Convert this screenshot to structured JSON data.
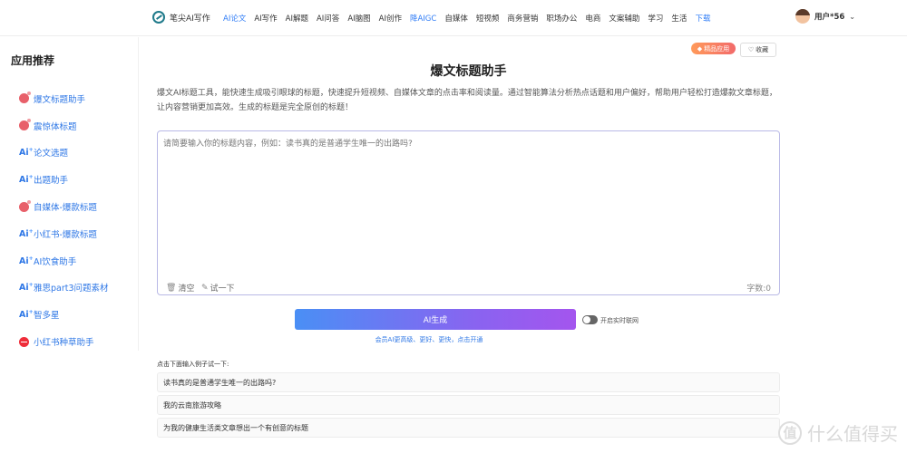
{
  "header": {
    "logo_text": "笔尖AI写作",
    "nav": [
      {
        "label": "AI论文",
        "highlight": true
      },
      {
        "label": "AI写作",
        "highlight": false
      },
      {
        "label": "AI解题",
        "highlight": false
      },
      {
        "label": "AI问答",
        "highlight": false
      },
      {
        "label": "AI脑图",
        "highlight": false
      },
      {
        "label": "AI创作",
        "highlight": false
      },
      {
        "label": "降AIGC",
        "highlight": true
      },
      {
        "label": "自媒体",
        "highlight": false
      },
      {
        "label": "短视频",
        "highlight": false
      },
      {
        "label": "商务营销",
        "highlight": false
      },
      {
        "label": "职场办公",
        "highlight": false
      },
      {
        "label": "电商",
        "highlight": false
      },
      {
        "label": "文案辅助",
        "highlight": false
      },
      {
        "label": "学习",
        "highlight": false
      },
      {
        "label": "生活",
        "highlight": false
      },
      {
        "label": "下载",
        "highlight": true
      }
    ],
    "user_name": "用户*56",
    "user_chevron": "⌄"
  },
  "sidebar": {
    "title": "应用推荐",
    "items": [
      {
        "label": "爆文标题助手",
        "icon": "bomb"
      },
      {
        "label": "震惊体标题",
        "icon": "bomb"
      },
      {
        "label": "论文选题",
        "icon": "ai"
      },
      {
        "label": "出题助手",
        "icon": "ai"
      },
      {
        "label": "自媒体-爆款标题",
        "icon": "bomb"
      },
      {
        "label": "小红书-爆款标题",
        "icon": "ai"
      },
      {
        "label": "AI饮食助手",
        "icon": "ai"
      },
      {
        "label": "雅思part3问题素材",
        "icon": "ai"
      },
      {
        "label": "智多星",
        "icon": "ai"
      },
      {
        "label": "小红书种草助手",
        "icon": "red"
      }
    ]
  },
  "main": {
    "premium_badge": "精品应用",
    "fav_label": "收藏",
    "title": "爆文标题助手",
    "description": "爆文AI标题工具，能快速生成吸引眼球的标题，快速提升短视频、自媒体文章的点击率和阅读量。通过智能算法分析热点话题和用户偏好，帮助用户轻松打造爆款文章标题，让内容营销更加高效。生成的标题是完全原创的标题！",
    "input_placeholder": "请简要输入你的标题内容，例如：读书真的是普通学生唯一的出路吗?",
    "clear_label": "清空",
    "try_label": "试一下",
    "char_count": "字数:0",
    "generate_label": "AI生成",
    "toggle_label": "开启实时联网",
    "vip_link": "会员AI更高级、更好、更快，点击开通",
    "examples_hint": "点击下面输入例子试一下:",
    "examples": [
      "读书真的是普通学生唯一的出路吗?",
      "我的云南旅游攻略",
      "为我的健康生活类文章想出一个有创意的标题"
    ]
  },
  "watermark": {
    "icon_char": "值",
    "text": "什么值得买"
  }
}
